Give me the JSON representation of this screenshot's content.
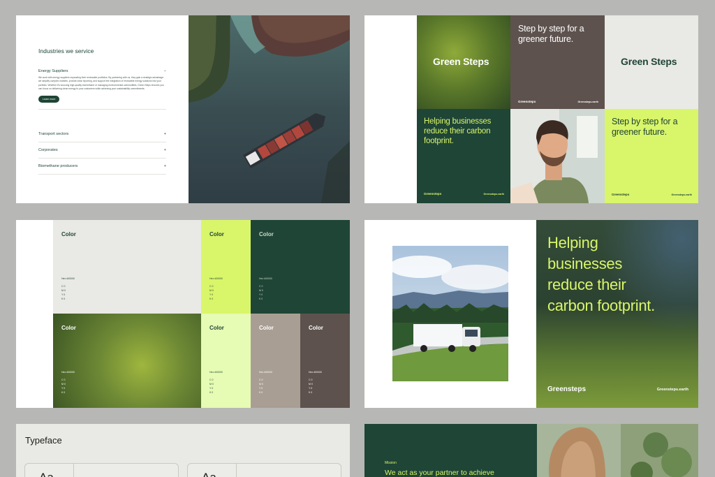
{
  "slide1": {
    "title": "Industries we service",
    "open_item": {
      "label": "Energy Suppliers",
      "toggle": "−",
      "body": "We work with energy suppliers expanding their renewable portfolios. By partnering with us, they gain a strategic advantage: we simplify complex markets, provide clear reporting, and support the integration of renewable energy solutions into your portfolio. Whether it's sourcing high-quality biomethane or managing environmental commodities, Green Steps ensures you can focus on delivering clean energy to your customers while achieving your sustainability commitments.",
      "button": "Learn more"
    },
    "items": [
      {
        "label": "Transport sectors",
        "toggle": "+"
      },
      {
        "label": "Corporates",
        "toggle": "+"
      },
      {
        "label": "Biomethane producers",
        "toggle": "+"
      }
    ]
  },
  "slide2": {
    "brand_title": "Green Steps",
    "tagline": "Step by step for a greener future.",
    "help_copy": "Helping businesses reduce their carbon footprint.",
    "brand_small": "Greensteps",
    "url": "Greensteps.earth",
    "colors": {
      "dark_green": "#1f4536",
      "lime": "#d9f56a",
      "taupe": "#5d524d",
      "light_gray": "#e9e9e5"
    }
  },
  "slide3": {
    "swatches": [
      {
        "label": "Color",
        "hex": "Hex  #00000",
        "cmyk": [
          "C  0",
          "M  0",
          "Y  0",
          "K  0"
        ],
        "color": "#e9e9e5"
      },
      {
        "label": "Color",
        "hex": "Hex  #00000",
        "cmyk": [
          "C  0",
          "M  0",
          "Y  0",
          "K  0"
        ],
        "color": "#d9f56a"
      },
      {
        "label": "Color",
        "hex": "Hex  #00000",
        "cmyk": [
          "C  0",
          "M  0",
          "Y  0",
          "K  0"
        ],
        "color": "#1f4536"
      },
      {
        "label": "Color",
        "hex": "Hex  #00000",
        "cmyk": [
          "C  0",
          "M  0",
          "Y  0",
          "K  0"
        ],
        "color": "#6f8a35"
      },
      {
        "label": "Color",
        "hex": "Hex  #00000",
        "cmyk": [
          "C  0",
          "M  0",
          "Y  0",
          "K  0"
        ],
        "color": "#e6fbb3"
      },
      {
        "label": "Color",
        "hex": "Hex  #00000",
        "cmyk": [
          "C  0",
          "M  0",
          "Y  0",
          "K  0"
        ],
        "color": "#a99e93"
      },
      {
        "label": "Color",
        "hex": "Hex  #00000",
        "cmyk": [
          "C  0",
          "M  0",
          "Y  0",
          "K  0"
        ],
        "color": "#5d524d"
      }
    ]
  },
  "slide4": {
    "headline_lines": [
      "Helping",
      "businesses",
      "reduce their",
      "carbon footprint."
    ],
    "brand": "Greensteps",
    "url": "Greensteps.earth"
  },
  "slide5": {
    "title": "Typeface",
    "samples": [
      "Aa",
      "Aa"
    ]
  },
  "slide6": {
    "label": "Mission",
    "text": "We act as your partner to achieve"
  }
}
